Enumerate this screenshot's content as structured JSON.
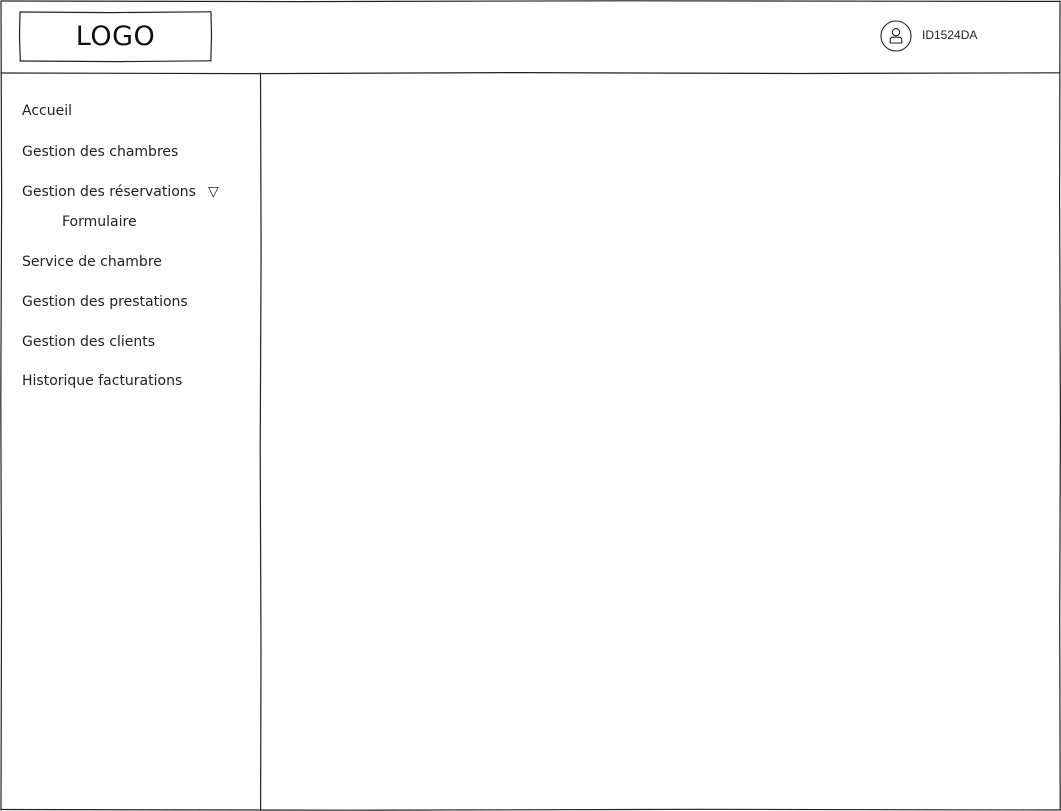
{
  "header": {
    "logo_text": "LOGO",
    "user_id": "ID1524DA",
    "user_icon": "user-icon"
  },
  "sidebar": {
    "items": [
      {
        "label": "Accueil"
      },
      {
        "label": "Gestion des chambres"
      },
      {
        "label": "Gestion des réservations",
        "expanded": true,
        "caret": "▽",
        "children": [
          {
            "label": "Formulaire"
          }
        ]
      },
      {
        "label": "Service de chambre"
      },
      {
        "label": "Gestion des prestations"
      },
      {
        "label": "Gestion des clients"
      },
      {
        "label": "Historique facturations"
      }
    ]
  },
  "colors": {
    "stroke": "#222222",
    "background": "#ffffff"
  }
}
